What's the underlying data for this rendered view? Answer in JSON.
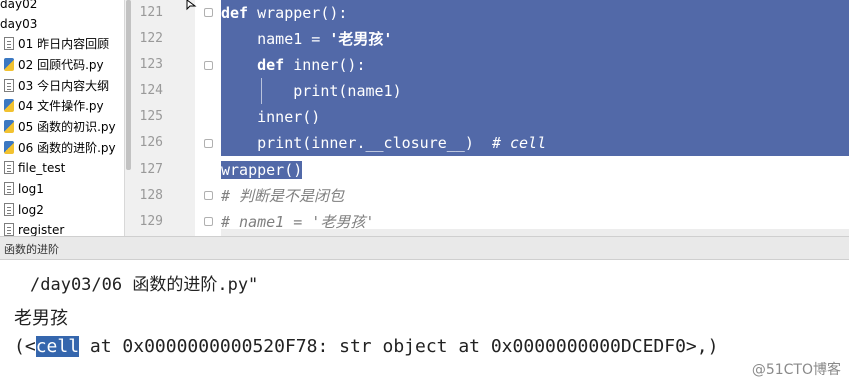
{
  "project_tree": {
    "items": [
      {
        "label": "day02",
        "icon": "folder-icon"
      },
      {
        "label": "day03",
        "icon": "folder-icon"
      },
      {
        "label": "01 昨日内容回顾",
        "icon": "text-file-icon"
      },
      {
        "label": "02 回顾代码.py",
        "icon": "python-file-icon"
      },
      {
        "label": "03 今日内容大纲",
        "icon": "text-file-icon"
      },
      {
        "label": "04 文件操作.py",
        "icon": "python-file-icon"
      },
      {
        "label": "05 函数的初识.py",
        "icon": "python-file-icon"
      },
      {
        "label": "06 函数的进阶.py",
        "icon": "python-file-icon"
      },
      {
        "label": "file_test",
        "icon": "text-file-icon"
      },
      {
        "label": "log1",
        "icon": "text-file-icon"
      },
      {
        "label": "log2",
        "icon": "text-file-icon"
      },
      {
        "label": "register",
        "icon": "text-file-icon"
      }
    ]
  },
  "editor": {
    "line_numbers": [
      "121",
      "122",
      "123",
      "124",
      "125",
      "126",
      "127",
      "128",
      "129"
    ],
    "lines": {
      "l121_kw": "def",
      "l121_rest": " wrapper():",
      "l122_a": "    name1 = ",
      "l122_str": "'老男孩'",
      "l123_kw": "def",
      "l123_rest": " inner():",
      "l124": "print(name1)",
      "l125": "    inner()",
      "l126_a": "    print(inner.__closure__)  ",
      "l126_cmt": "# cell",
      "l127": "wrapper()",
      "l128": "# 判断是不是闭包",
      "l129": "# name1 = '老男孩'"
    }
  },
  "run_tab": {
    "label": "函数的进阶"
  },
  "console": {
    "line1": "/day03/06 函数的进阶.py\"",
    "line2": "老男孩",
    "line3_pre": "(<",
    "line3_sel": "cell",
    "line3_post": " at 0x0000000000520F78: str object at 0x0000000000DCEDF0>,)"
  },
  "watermark": "@51CTO博客",
  "colors": {
    "selection": "#5269a8",
    "console_selection": "#3566ad",
    "gutter": "#f0f0f0"
  }
}
